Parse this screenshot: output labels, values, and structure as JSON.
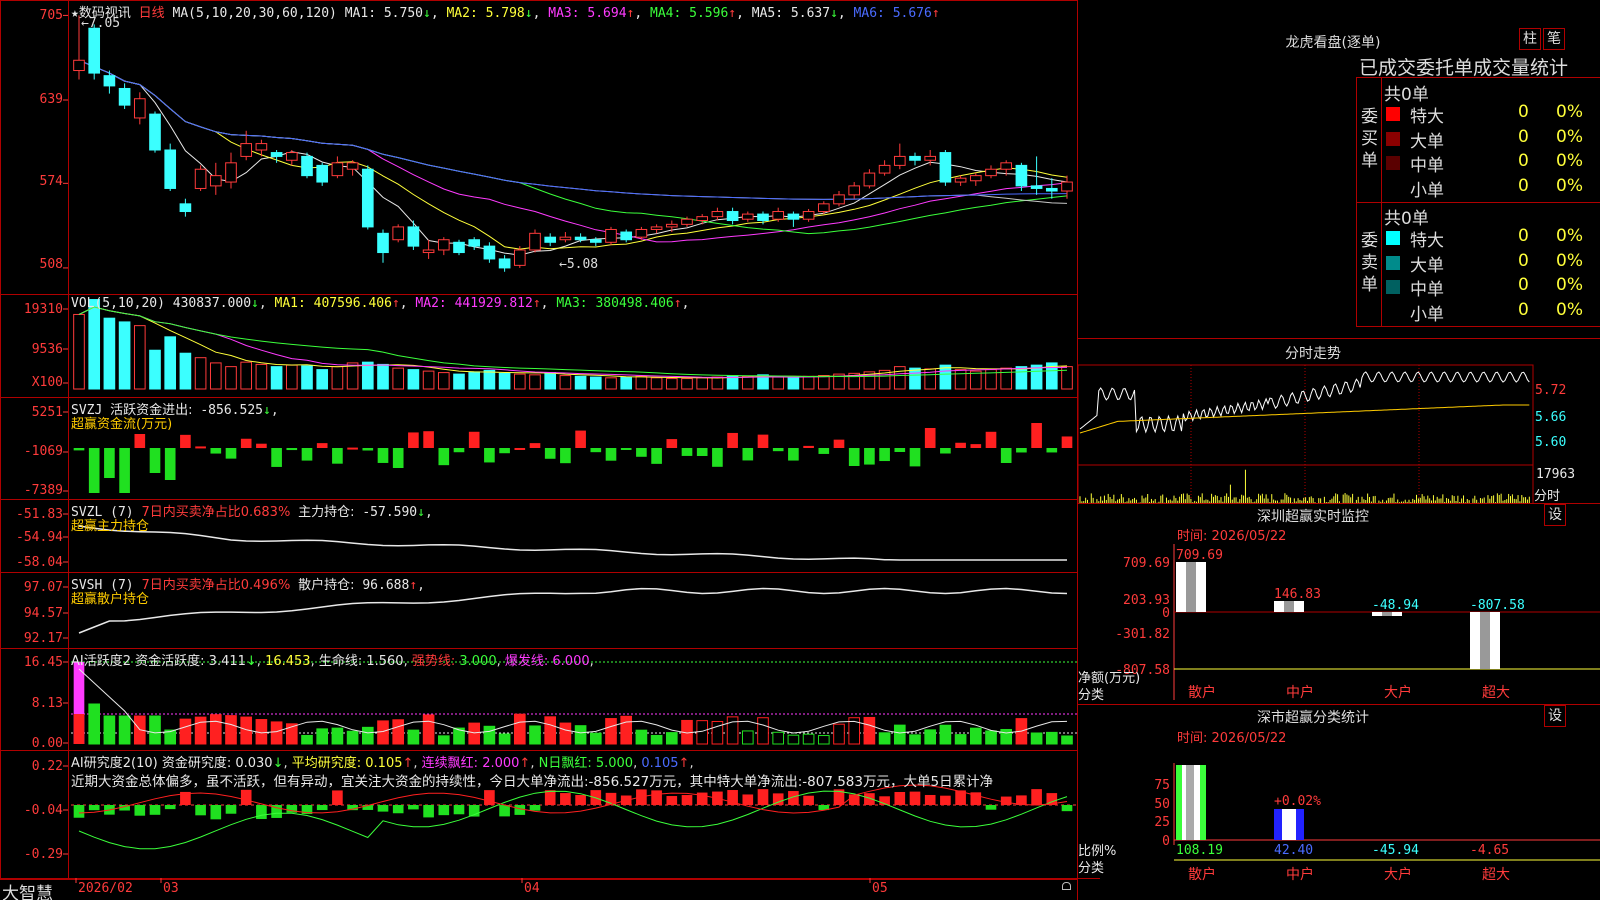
{
  "app": {
    "brand": "大智慧"
  },
  "main": {
    "star": "★",
    "stock_name": "数码视讯",
    "period": "日线",
    "ma_header": "MA(5,10,20,30,60,120)",
    "ma_values": [
      {
        "label": "MA1:",
        "value": "5.750",
        "arrow": "↓",
        "color": "#e8e8e8"
      },
      {
        "label": "MA2:",
        "value": "5.798",
        "arrow": "↓",
        "color": "#ffff3a"
      },
      {
        "label": "MA3:",
        "value": "5.694",
        "arrow": "↑",
        "color": "#ff3bff"
      },
      {
        "label": "MA4:",
        "value": "5.596",
        "arrow": "↑",
        "color": "#3bff3b"
      },
      {
        "label": "MA5:",
        "value": "5.637",
        "arrow": "↓",
        "color": "#e8e8e8"
      },
      {
        "label": "MA6:",
        "value": "5.676",
        "arrow": "↑",
        "color": "#4a6bff"
      }
    ],
    "y_ticks": [
      "705",
      "639",
      "574",
      "508"
    ],
    "high_label": "7.05",
    "low_label": "5.08"
  },
  "vol": {
    "header": "VOL(5,10,20)",
    "value": "430837.000",
    "value_arrow": "↓",
    "ma": [
      {
        "label": "MA1:",
        "value": "407596.406",
        "arrow": "↑",
        "color": "#ffff3a"
      },
      {
        "label": "MA2:",
        "value": "441929.812",
        "arrow": "↑",
        "color": "#ff3bff"
      },
      {
        "label": "MA3:",
        "value": "380498.406",
        "arrow": "↑",
        "color": "#3bff3b"
      }
    ],
    "y_ticks": [
      "19310",
      "9536",
      "X100"
    ]
  },
  "svzj": {
    "name": "SVZJ",
    "label": "活跃资金进出:",
    "value": "-856.525",
    "arrow": "↓",
    "sub": "超赢资金流(万元)",
    "y_ticks": [
      "5251",
      "-1069",
      "-7389"
    ]
  },
  "svzl": {
    "name": "SVZL (7)",
    "text1": "7日内买卖净占比0.683%",
    "label": "主力持仓:",
    "value": "-57.590",
    "arrow": "↓",
    "sub": "超赢主力持仓",
    "y_ticks": [
      "-51.83",
      "-54.94",
      "-58.04"
    ]
  },
  "svsh": {
    "name": "SVSH (7)",
    "text1": "7日内买卖净占比0.496%",
    "label": "散户持仓:",
    "value": "96.688",
    "arrow": "↑",
    "sub": "超赢散户持仓",
    "y_ticks": [
      "97.07",
      "94.57",
      "92.17"
    ]
  },
  "ai1": {
    "name": "AI活跃度2",
    "l1": "资金活跃度:",
    "v1": "3.411",
    "a1": "↓",
    "v2": "16.453",
    "l3": "生命线:",
    "v3": "1.560",
    "l4": "强势线:",
    "v4": "3.000",
    "l5": "爆发线:",
    "v5": "6.000",
    "y_ticks": [
      "16.45",
      "8.13",
      "0.00"
    ]
  },
  "ai2": {
    "name": "AI研究度2(10)",
    "l1": "资金研究度:",
    "v1": "0.030",
    "a1": "↓",
    "l2": "平均研究度:",
    "v2": "0.105",
    "a2": "↑",
    "l3": "连续飘红:",
    "v3": "2.000",
    "a3": "↑",
    "l4": "N日飘红:",
    "v4": "5.000",
    "v5": "0.105",
    "a5": "↑",
    "comment": "近期大资金总体偏多，虽不活跃，但有异动，宜关注大资金的持续性，今日大单净流出:-856.527万元，其中特大单净流出:-807.583万元，大单5日累计净",
    "y_ticks": [
      "0.22",
      "-0.04",
      "-0.29"
    ]
  },
  "xaxis": {
    "labels": [
      "2026/02",
      "03",
      "04",
      "05"
    ]
  },
  "dragon": {
    "title": "龙虎看盘(逐单)",
    "btn1": "柱",
    "btn2": "笔",
    "subtitle": "已成交委托单成交量统计",
    "buy": {
      "side": "委买单",
      "count": "共0单",
      "rows": [
        {
          "label": "特大",
          "n": "0",
          "p": "0%",
          "color": "#ff0000"
        },
        {
          "label": "大单",
          "n": "0",
          "p": "0%",
          "color": "#8b0000"
        },
        {
          "label": "中单",
          "n": "0",
          "p": "0%",
          "color": "#5a0000"
        },
        {
          "label": "小单",
          "n": "0",
          "p": "0%",
          "color": "#000000"
        }
      ]
    },
    "sell": {
      "side": "委卖单",
      "count": "共0单",
      "rows": [
        {
          "label": "特大",
          "n": "0",
          "p": "0%",
          "color": "#00ffff"
        },
        {
          "label": "大单",
          "n": "0",
          "p": "0%",
          "color": "#008b8b"
        },
        {
          "label": "中单",
          "n": "0",
          "p": "0%",
          "color": "#006060"
        },
        {
          "label": "小单",
          "n": "0",
          "p": "0%",
          "color": "#000000"
        }
      ]
    }
  },
  "intraday": {
    "title": "分时走势",
    "y_ticks": [
      "5.72",
      "5.66",
      "5.60"
    ],
    "vol_tick": "17963",
    "vol_unit": "分时"
  },
  "monitor": {
    "title": "深圳超赢实时监控",
    "btn": "设",
    "time": "时间: 2026/05/22",
    "y_ticks": [
      "709.69",
      "203.93",
      "0",
      "-301.82",
      "-807.58"
    ],
    "ylabel": "净额(万元)",
    "xlabel": "分类",
    "categories": [
      "散户",
      "中户",
      "大户",
      "超大"
    ],
    "values": [
      "709.69",
      "146.83",
      "-48.94",
      "-807.58"
    ]
  },
  "classify": {
    "title": "深市超赢分类统计",
    "btn": "设",
    "time": "时间: 2026/05/22",
    "y_ticks": [
      "75",
      "50",
      "25",
      "0"
    ],
    "ylabel": "比例%",
    "xlabel": "分类",
    "categories": [
      "散户",
      "中户",
      "大户",
      "超大"
    ],
    "values": [
      "108.19",
      "42.40",
      "-45.94",
      "-4.65"
    ],
    "annotation": "+0.02%"
  },
  "chart_data": [
    {
      "type": "candlestick",
      "y_ticks": [
        "705",
        "639",
        "574",
        "508"
      ],
      "ylim": [
        4.9,
        7.1
      ],
      "candles": [
        [
          6.62,
          6.7,
          6.55,
          7.05
        ],
        [
          6.95,
          6.6,
          6.55,
          6.98
        ],
        [
          6.58,
          6.5,
          6.44,
          6.62
        ],
        [
          6.48,
          6.35,
          6.32,
          6.52
        ],
        [
          6.25,
          6.4,
          6.2,
          6.45
        ],
        [
          6.28,
          6.0,
          5.98,
          6.3
        ],
        [
          6.0,
          5.7,
          5.68,
          6.05
        ],
        [
          5.58,
          5.52,
          5.48,
          5.62
        ],
        [
          5.7,
          5.85,
          5.68,
          5.88
        ],
        [
          5.72,
          5.8,
          5.65,
          5.9
        ],
        [
          5.75,
          5.9,
          5.7,
          5.98
        ],
        [
          5.95,
          6.05,
          5.92,
          6.15
        ],
        [
          6.0,
          6.05,
          5.95,
          6.08
        ],
        [
          5.98,
          5.95,
          5.9,
          6.0
        ],
        [
          5.92,
          5.98,
          5.88,
          6.0
        ],
        [
          5.95,
          5.8,
          5.78,
          5.98
        ],
        [
          5.88,
          5.75,
          5.72,
          5.9
        ],
        [
          5.8,
          5.9,
          5.78,
          5.95
        ],
        [
          5.85,
          5.9,
          5.8,
          5.92
        ],
        [
          5.85,
          5.4,
          5.38,
          5.88
        ],
        [
          5.35,
          5.2,
          5.12,
          5.38
        ],
        [
          5.3,
          5.4,
          5.28,
          5.42
        ],
        [
          5.4,
          5.25,
          5.22,
          5.45
        ],
        [
          5.2,
          5.22,
          5.15,
          5.3
        ],
        [
          5.22,
          5.3,
          5.18,
          5.32
        ],
        [
          5.28,
          5.2,
          5.18,
          5.3
        ],
        [
          5.3,
          5.25,
          5.22,
          5.32
        ],
        [
          5.25,
          5.15,
          5.12,
          5.28
        ],
        [
          5.15,
          5.08,
          5.05,
          5.18
        ],
        [
          5.1,
          5.22,
          5.08,
          5.25
        ],
        [
          5.22,
          5.35,
          5.2,
          5.38
        ],
        [
          5.32,
          5.28,
          5.25,
          5.35
        ],
        [
          5.3,
          5.32,
          5.28,
          5.36
        ],
        [
          5.32,
          5.3,
          5.28,
          5.35
        ],
        [
          5.3,
          5.28,
          5.25,
          5.32
        ],
        [
          5.28,
          5.38,
          5.26,
          5.4
        ],
        [
          5.36,
          5.3,
          5.28,
          5.38
        ],
        [
          5.32,
          5.38,
          5.3,
          5.4
        ],
        [
          5.38,
          5.4,
          5.35,
          5.42
        ],
        [
          5.4,
          5.42,
          5.36,
          5.45
        ],
        [
          5.42,
          5.46,
          5.4,
          5.48
        ],
        [
          5.45,
          5.48,
          5.42,
          5.5
        ],
        [
          5.48,
          5.52,
          5.45,
          5.55
        ],
        [
          5.52,
          5.45,
          5.42,
          5.55
        ],
        [
          5.46,
          5.5,
          5.44,
          5.52
        ],
        [
          5.5,
          5.45,
          5.42,
          5.52
        ],
        [
          5.46,
          5.52,
          5.44,
          5.55
        ],
        [
          5.5,
          5.46,
          5.4,
          5.52
        ],
        [
          5.46,
          5.52,
          5.44,
          5.54
        ],
        [
          5.52,
          5.58,
          5.5,
          5.6
        ],
        [
          5.58,
          5.65,
          5.56,
          5.68
        ],
        [
          5.65,
          5.72,
          5.62,
          5.75
        ],
        [
          5.72,
          5.82,
          5.7,
          5.85
        ],
        [
          5.82,
          5.88,
          5.8,
          5.92
        ],
        [
          5.88,
          5.95,
          5.85,
          6.05
        ],
        [
          5.95,
          5.92,
          5.88,
          5.98
        ],
        [
          5.92,
          5.95,
          5.88,
          6.0
        ],
        [
          5.98,
          5.75,
          5.72,
          6.0
        ],
        [
          5.75,
          5.78,
          5.72,
          5.8
        ],
        [
          5.76,
          5.8,
          5.72,
          5.82
        ],
        [
          5.8,
          5.85,
          5.78,
          5.88
        ],
        [
          5.85,
          5.9,
          5.8,
          5.92
        ],
        [
          5.88,
          5.72,
          5.68,
          5.9
        ],
        [
          5.72,
          5.7,
          5.65,
          5.95
        ],
        [
          5.7,
          5.68,
          5.62,
          5.78
        ],
        [
          5.68,
          5.75,
          5.62,
          5.8
        ]
      ]
    },
    {
      "type": "bar",
      "name": "VOL",
      "y_ticks": [
        "19310",
        "9536",
        "X100"
      ],
      "values": [
        1000,
        1200,
        950,
        900,
        850,
        520,
        700,
        480,
        420,
        350,
        300,
        360,
        330,
        300,
        320,
        310,
        260,
        300,
        350,
        360,
        330,
        280,
        260,
        240,
        220,
        200,
        230,
        250,
        210,
        200,
        190,
        220,
        180,
        170,
        160,
        150,
        160,
        170,
        150,
        140,
        140,
        150,
        160,
        180,
        170,
        190,
        160,
        150,
        170,
        180,
        200,
        210,
        230,
        250,
        300,
        280,
        270,
        320,
        260,
        240,
        260,
        280,
        300,
        320,
        350,
        300
      ]
    }
  ]
}
